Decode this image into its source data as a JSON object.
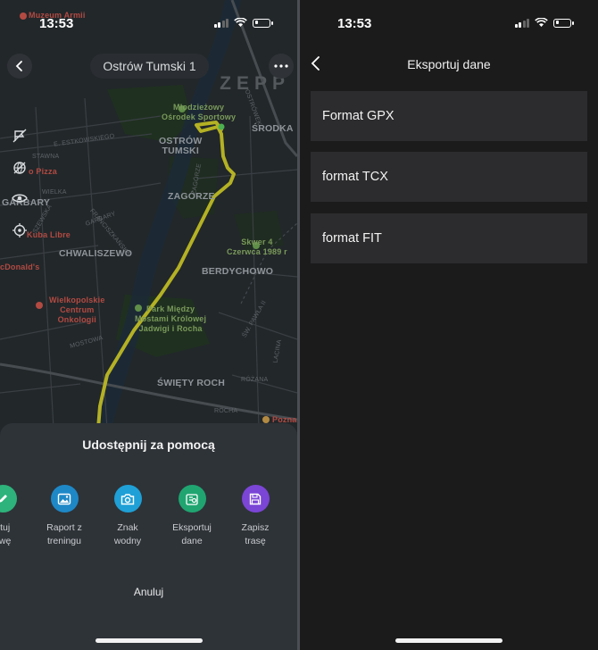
{
  "left": {
    "status": {
      "time": "13:53"
    },
    "location_title": "Ostrów Tumski 1",
    "watermark": "ZEPP",
    "map_labels": {
      "museum": "Muzeum Armii",
      "stadium": "Młodzieżowy\nOśrodek Sportowy",
      "ostrow": "OSTRÓW\nTUMSKI",
      "srodka": "ŚRODKA",
      "pizza": "o Pizza",
      "garbary": "GARBARY",
      "zagorze": "ZAGÓRZE",
      "kuba": "Kuba Libre",
      "chwaliszewo": "CHWALISZEWO",
      "skwer": "Skwer 4\nCzerwca 1989 r",
      "mcdonalds": "cDonald's",
      "berdychowo": "BERDYCHOWO",
      "hospital": "Wielkopolskie\nCentrum\nOnkologii",
      "park": "Park Między\nMostami Królowej\nJadwigi i Rocha",
      "swiety_roch": "ŚWIĘTY ROCH",
      "poznan": "Pozna",
      "st_estkowskiego": "E. ESTKOWSKIEGO",
      "st_stawna": "STAWNA",
      "st_wielka": "WIELKA",
      "st_szewska": "SZEWSKA",
      "st_franciszkanska": "FRANCISZKAŃSKA",
      "st_garbary": "GARBARY",
      "st_mostowa": "MOSTOWA",
      "st_pawla": "ŚW. PAWŁA II",
      "st_lacina": "LACINA",
      "st_rozana": "RÓŻANA",
      "st_rocha": "ROCHA",
      "st_ostrowek": "OSTRÓWEK",
      "st_zagorze": "ZAGÓRZE"
    },
    "share_sheet": {
      "title": "Udostępnij za pomocą",
      "options": [
        {
          "label": "ytuj\nzwę",
          "icon": "pencil-icon",
          "color": "#2db37b"
        },
        {
          "label": "Raport z\ntreningu",
          "icon": "image-icon",
          "color": "#1e88c7"
        },
        {
          "label": "Znak\nwodny",
          "icon": "camera-icon",
          "color": "#1fa0d6"
        },
        {
          "label": "Eksportuj\ndane",
          "icon": "export-icon",
          "color": "#20a571"
        },
        {
          "label": "Zapisz\ntrasę",
          "icon": "save-icon",
          "color": "#7b45d6"
        }
      ],
      "cancel": "Anuluj"
    },
    "route_color": "#b4b124"
  },
  "right": {
    "status": {
      "time": "13:53"
    },
    "title": "Eksportuj dane",
    "formats": [
      "Format GPX",
      "format TCX",
      "format FIT"
    ]
  }
}
